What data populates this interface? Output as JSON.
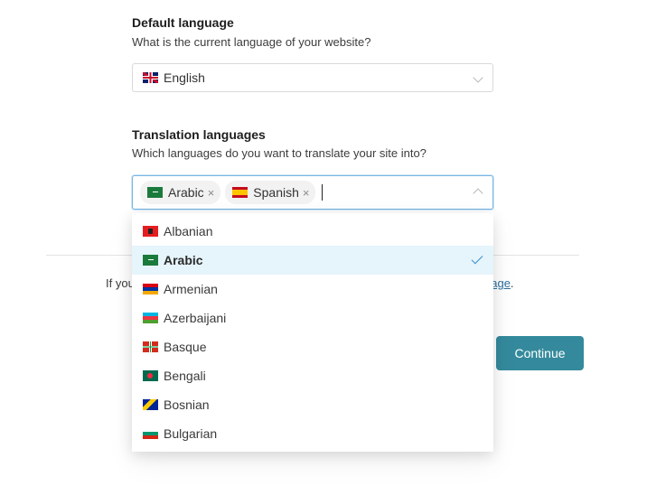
{
  "default_language": {
    "title": "Default language",
    "description": "What is the current language of your website?",
    "selected": {
      "label": "English",
      "flag": "uk-flag-icon"
    }
  },
  "translation_languages": {
    "title": "Translation languages",
    "description": "Which languages do you want to translate your site into?",
    "chips": [
      {
        "label": "Arabic",
        "flag": "saudi-flag-icon",
        "remove": "×"
      },
      {
        "label": "Spanish",
        "flag": "spain-flag-icon",
        "remove": "×"
      }
    ],
    "input_value": ""
  },
  "dropdown": {
    "options": [
      {
        "label": "Albanian",
        "flag": "albania-flag-icon",
        "selected": false
      },
      {
        "label": "Arabic",
        "flag": "saudi-flag-icon",
        "selected": true
      },
      {
        "label": "Armenian",
        "flag": "armenia-flag-icon",
        "selected": false
      },
      {
        "label": "Azerbaijani",
        "flag": "azerbaijan-flag-icon",
        "selected": false
      },
      {
        "label": "Basque",
        "flag": "basque-flag-icon",
        "selected": false
      },
      {
        "label": "Bengali",
        "flag": "bangladesh-flag-icon",
        "selected": false
      },
      {
        "label": "Bosnian",
        "flag": "bosnia-flag-icon",
        "selected": false
      },
      {
        "label": "Bulgarian",
        "flag": "bulgaria-flag-icon",
        "selected": false
      }
    ]
  },
  "footer": {
    "note_start": "If you",
    "note_link_end": "uage",
    "note_end_punct": "."
  },
  "actions": {
    "continue_label": "Continue"
  },
  "colors": {
    "primary_button": "#348a9c",
    "focus_border": "#79b6e2",
    "selected_option_bg": "#e6f4fb",
    "check": "#3b8fd1"
  }
}
